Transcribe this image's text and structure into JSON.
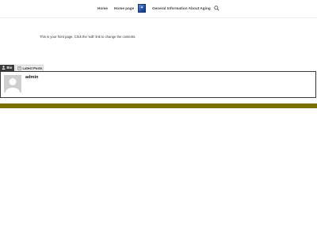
{
  "nav": {
    "items": [
      "Home",
      "Home page",
      "General Information About Aging"
    ],
    "logo_icon": "blue-square-logo-icon",
    "search_icon": "search-icon"
  },
  "content": {
    "front_page_text": "This is your front page. Click the 'edit' link to change the contents."
  },
  "author_box": {
    "tabs": [
      {
        "label": "Bio",
        "icon": "person-icon",
        "active": true
      },
      {
        "label": "Latest Posts",
        "icon": "document-icon",
        "active": false
      }
    ],
    "author_name": "admin",
    "avatar_icon": "default-avatar-icon"
  },
  "colors": {
    "footer_bar": "#7a7000",
    "active_tab": "#3a3a3a"
  }
}
